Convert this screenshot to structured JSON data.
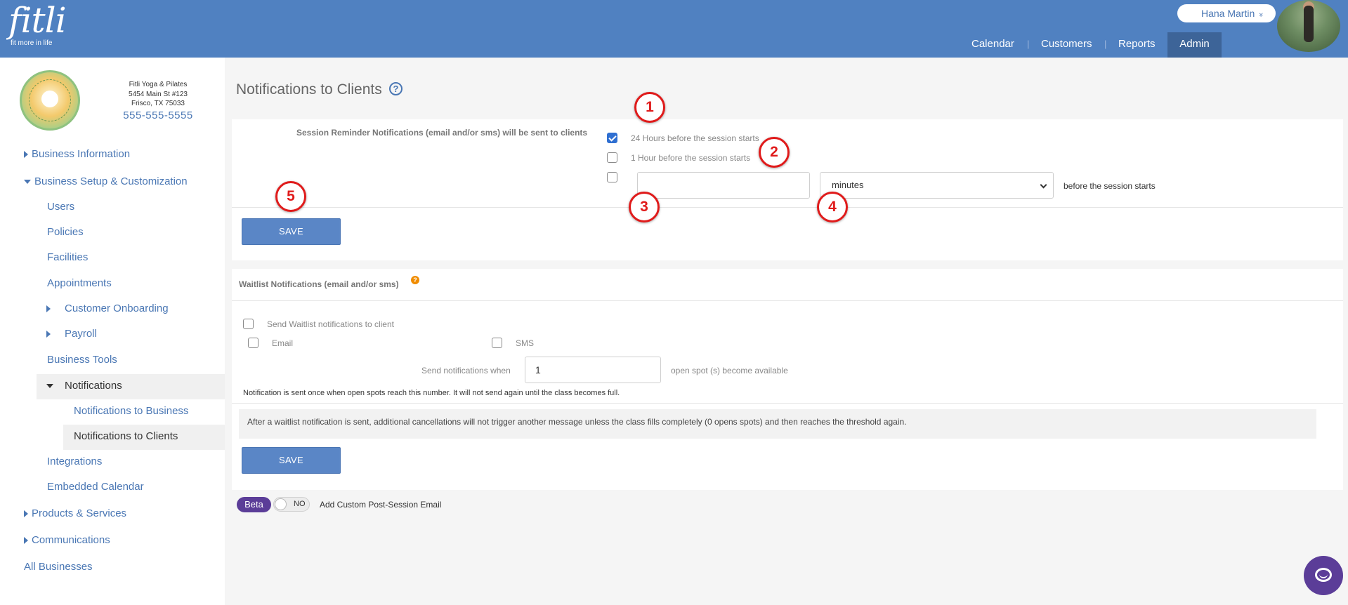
{
  "header": {
    "logo_text": "fitli",
    "logo_tagline": "fit more in life",
    "user_name": "Hana Martin",
    "user_chevron": "»",
    "nav": [
      "Calendar",
      "Customers",
      "Reports",
      "Admin"
    ],
    "nav_separator": "|"
  },
  "sidebar": {
    "business": {
      "name": "Fitli Yoga & Pilates",
      "address1": "5454 Main St #123",
      "address2": "Frisco, TX 75033",
      "phone": "555-555-5555"
    },
    "items": {
      "business_information": "Business Information",
      "business_setup": "Business Setup & Customization",
      "users": "Users",
      "policies": "Policies",
      "facilities": "Facilities",
      "appointments": "Appointments",
      "customer_onboarding": "Customer Onboarding",
      "payroll": "Payroll",
      "business_tools": "Business Tools",
      "notifications": "Notifications",
      "notifications_to_business": "Notifications to Business",
      "notifications_to_clients": "Notifications to Clients",
      "integrations": "Integrations",
      "embedded_calendar": "Embedded Calendar",
      "products_services": "Products & Services",
      "communications": "Communications",
      "all_businesses": "All Businesses"
    }
  },
  "main": {
    "page_title": "Notifications to Clients",
    "help_glyph": "?",
    "session_reminder": {
      "label": "Session Reminder Notifications (email and/or sms) will be sent to clients",
      "option_24h": "24 Hours before the session starts",
      "option_24h_checked": true,
      "option_1h": "1 Hour before the session starts",
      "option_1h_checked": false,
      "custom_checked": false,
      "custom_value": "",
      "custom_unit": "minutes",
      "custom_suffix": "before the session starts",
      "save_label": "SAVE"
    },
    "waitlist": {
      "title": "Waitlist Notifications (email and/or sms)",
      "info_glyph": "?",
      "send_label": "Send Waitlist notifications to client",
      "email_label": "Email",
      "sms_label": "SMS",
      "send_when_label": "Send notifications when",
      "spots_value": "1",
      "spots_suffix": "open spot (s) become available",
      "hint": "Notification is sent once when open spots reach this number. It will not send again until the class becomes full.",
      "note": "After a waitlist notification is sent, additional cancellations will not trigger another message unless the class fills completely (0 opens spots) and then reaches the threshold again.",
      "save_label": "SAVE"
    },
    "post_session": {
      "beta_label": "Beta",
      "toggle_state": "NO",
      "label": "Add Custom Post-Session Email"
    }
  },
  "annotations": [
    "1",
    "2",
    "3",
    "4",
    "5"
  ],
  "colors": {
    "header_bg": "#5081c1",
    "admin_tab_bg": "#3d6498",
    "link": "#4a77b4",
    "button": "#5a86c6",
    "marker": "#e01b1b",
    "beta": "#5b3d98",
    "chat": "#5b3d98"
  }
}
